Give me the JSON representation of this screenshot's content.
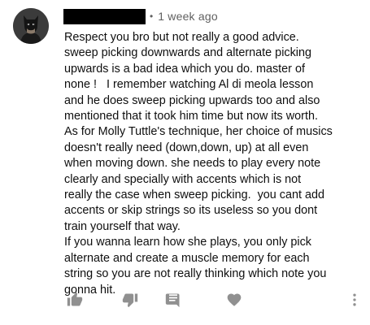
{
  "comment": {
    "author": "",
    "timestamp_separator": "•",
    "timestamp": "1 week ago",
    "lines": [
      "Respect you bro but not really a good advice.",
      "sweep picking downwards and alternate picking",
      "upwards is a bad idea which you do. master of",
      "none !   I remember watching Al di meola lesson",
      "and he does sweep picking upwards too and also",
      "mentioned that it took him time but now its worth.",
      "As for Molly Tuttle's technique, her choice of musics",
      "doesn't really need (down,down, up) at all even",
      "when moving down. she needs to play every note",
      "clearly and specially with accents which is not",
      "really the case when sweep picking.  you cant add",
      "accents or skip strings so its useless so you dont",
      "train yourself that way.",
      "If you wanna learn how she plays, you only pick",
      "alternate and create a muscle memory for each",
      "string so you are not really thinking which note you",
      "gonna hit."
    ]
  },
  "actions": {
    "like_icon": "thumb-up-icon",
    "dislike_icon": "thumb-down-icon",
    "reply_icon": "comment-icon",
    "heart_icon": "heart-icon",
    "more_icon": "more-vertical-icon"
  },
  "colors": {
    "text": "#0f0f0f",
    "meta": "#606060",
    "icon": "#909090"
  }
}
